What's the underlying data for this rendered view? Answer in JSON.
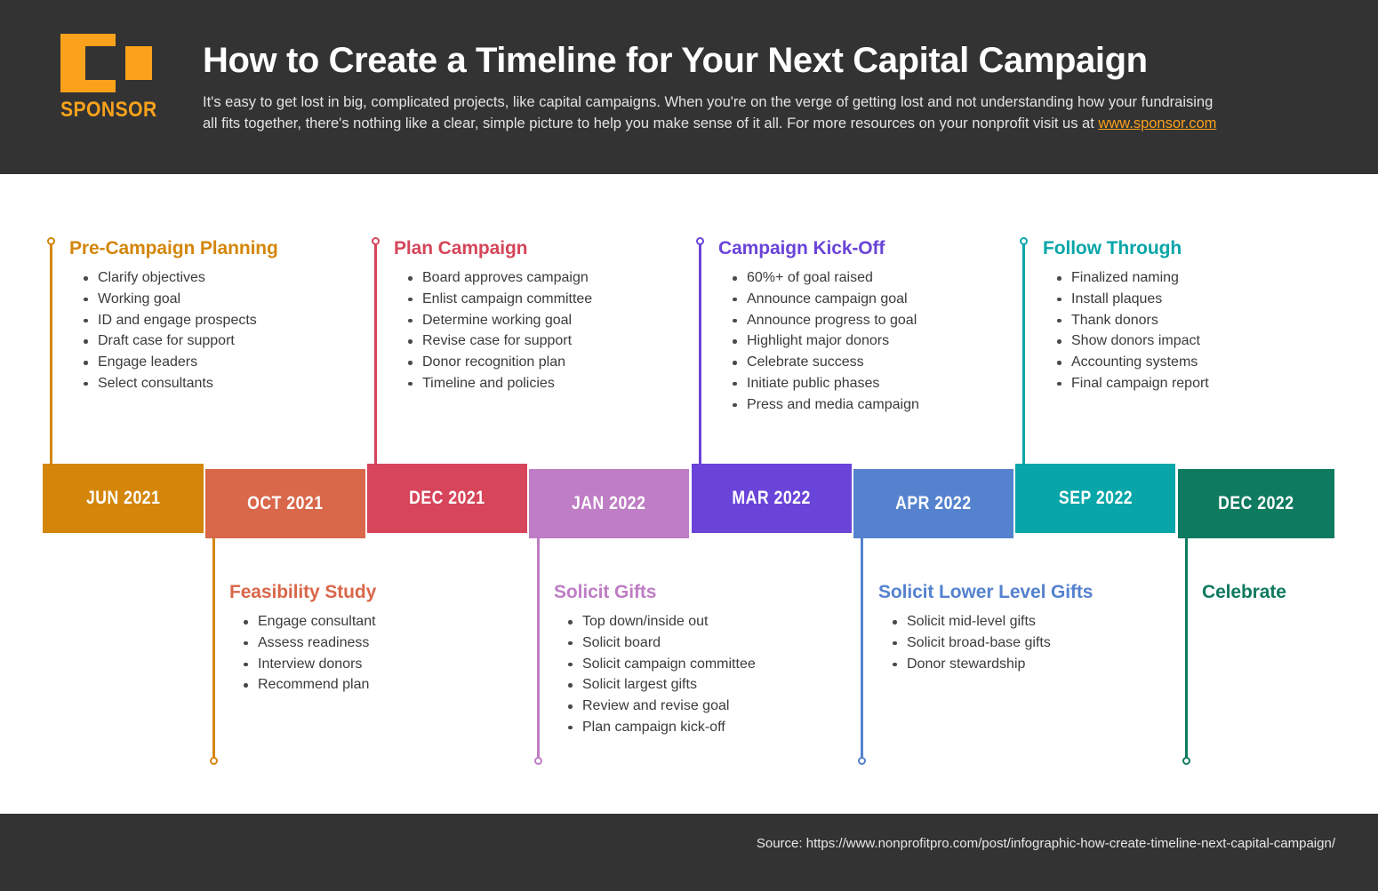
{
  "header": {
    "logo_text": "SPONSOR",
    "logo_color": "#FAA21B",
    "title": "How to Create a Timeline for Your Next Capital Campaign",
    "subtitle_part1": "It's easy to get lost in big, complicated projects, like capital campaigns. When you're on the verge of getting lost and not understanding how your fundraising all fits together, there's nothing like a clear, simple picture to help you make sense of it all. For more resources on your nonprofit visit us at ",
    "subtitle_link": "www.sponsor.com",
    "background": "#333333"
  },
  "timeline": {
    "blocks": [
      {
        "label": "JUN 2021",
        "color": "#D4860B"
      },
      {
        "label": "OCT 2021",
        "color": "#D9674A"
      },
      {
        "label": "DEC 2021",
        "color": "#D6455A"
      },
      {
        "label": "JAN 2022",
        "color": "#BE7DC4"
      },
      {
        "label": "MAR 2022",
        "color": "#6A44D9"
      },
      {
        "label": "APR 2022",
        "color": "#5582CE"
      },
      {
        "label": "SEP 2022",
        "color": "#08A6A8"
      },
      {
        "label": "DEC 2022",
        "color": "#0E7A5F"
      }
    ]
  },
  "cards_top": [
    {
      "title": "Pre-Campaign Planning",
      "color": "#D4860B",
      "items": [
        "Clarify objectives",
        "Working goal",
        "ID and engage prospects",
        "Draft case for support",
        "Engage leaders",
        "Select consultants"
      ]
    },
    {
      "title": "Plan Campaign",
      "color": "#D6455A",
      "items": [
        "Board approves campaign",
        "Enlist campaign committee",
        "Determine working goal",
        "Revise case for support",
        "Donor recognition plan",
        "Timeline and policies"
      ]
    },
    {
      "title": "Campaign Kick-Off",
      "color": "#6A44D9",
      "items": [
        "60%+ of goal raised",
        "Announce campaign goal",
        "Announce progress to goal",
        "Highlight major donors",
        "Celebrate success",
        "Initiate public phases",
        "Press and media campaign"
      ]
    },
    {
      "title": "Follow Through",
      "color": "#08A6A8",
      "items": [
        "Finalized naming",
        "Install plaques",
        "Thank donors",
        "Show donors impact",
        "Accounting systems",
        "Final campaign report"
      ]
    }
  ],
  "cards_bottom": [
    {
      "title": "Feasibility Study",
      "color": "#D9674A",
      "line_color": "#D4860B",
      "items": [
        "Engage consultant",
        "Assess readiness",
        "Interview donors",
        "Recommend plan"
      ]
    },
    {
      "title": "Solicit Gifts",
      "color": "#BE7DC4",
      "line_color": "#BE7DC4",
      "items": [
        "Top down/inside out",
        "Solicit board",
        "Solicit campaign committee",
        "Solicit largest gifts",
        "Review and revise goal",
        "Plan campaign kick-off"
      ]
    },
    {
      "title": "Solicit Lower Level Gifts",
      "color": "#5582CE",
      "line_color": "#5582CE",
      "items": [
        "Solicit mid-level gifts",
        "Solicit broad-base gifts",
        "Donor stewardship"
      ]
    },
    {
      "title": "Celebrate",
      "color": "#0E7A5F",
      "line_color": "#0E7A5F",
      "items": []
    }
  ],
  "footer": {
    "source": "Source: https://www.nonprofitpro.com/post/infographic-how-create-timeline-next-capital-campaign/"
  }
}
